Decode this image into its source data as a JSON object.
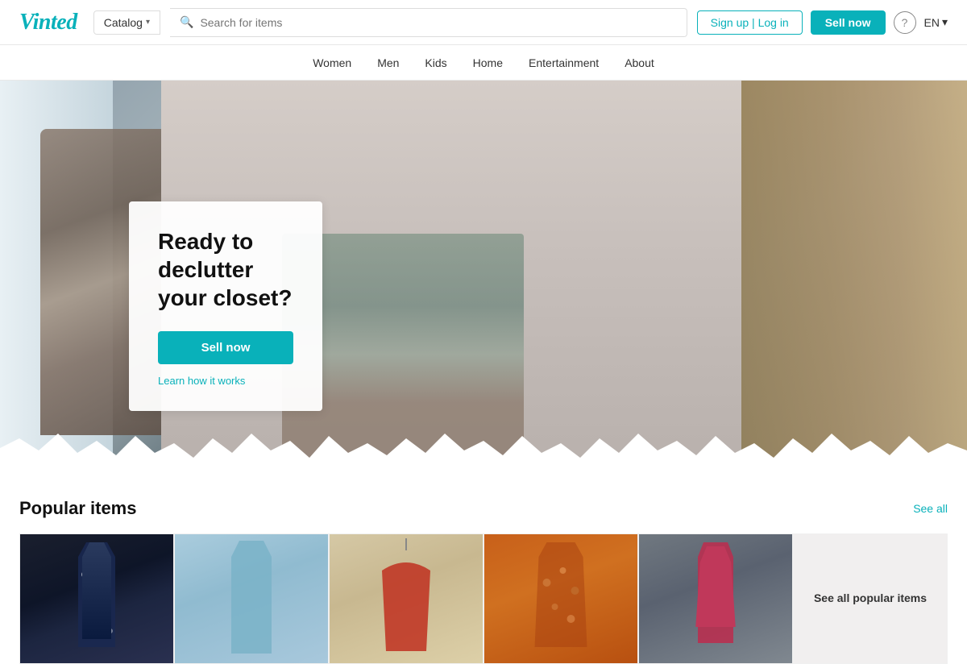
{
  "header": {
    "logo": "Vinted",
    "catalog_label": "Catalog",
    "search_placeholder": "Search for items",
    "signin_label": "Sign up | Log in",
    "sell_label": "Sell now",
    "help_label": "?",
    "lang_label": "EN"
  },
  "nav": {
    "items": [
      {
        "label": "Women"
      },
      {
        "label": "Men"
      },
      {
        "label": "Kids"
      },
      {
        "label": "Home"
      },
      {
        "label": "Entertainment"
      },
      {
        "label": "About"
      }
    ]
  },
  "hero": {
    "title": "Ready to declutter your closet?",
    "sell_label": "Sell now",
    "learn_label": "Learn how it works"
  },
  "popular": {
    "title": "Popular items",
    "see_all_label": "See all",
    "items": [
      {
        "id": 1,
        "alt": "Dark floral dress"
      },
      {
        "id": 2,
        "alt": "Light blue t-shirt dress"
      },
      {
        "id": 3,
        "alt": "Red slip dress on hanger"
      },
      {
        "id": 4,
        "alt": "Orange floral dress"
      },
      {
        "id": 5,
        "alt": "Pink spaghetti strap dress"
      },
      {
        "id": 6,
        "alt": "See all popular items",
        "is_cta": true,
        "cta_text": "See all popular items"
      }
    ]
  }
}
